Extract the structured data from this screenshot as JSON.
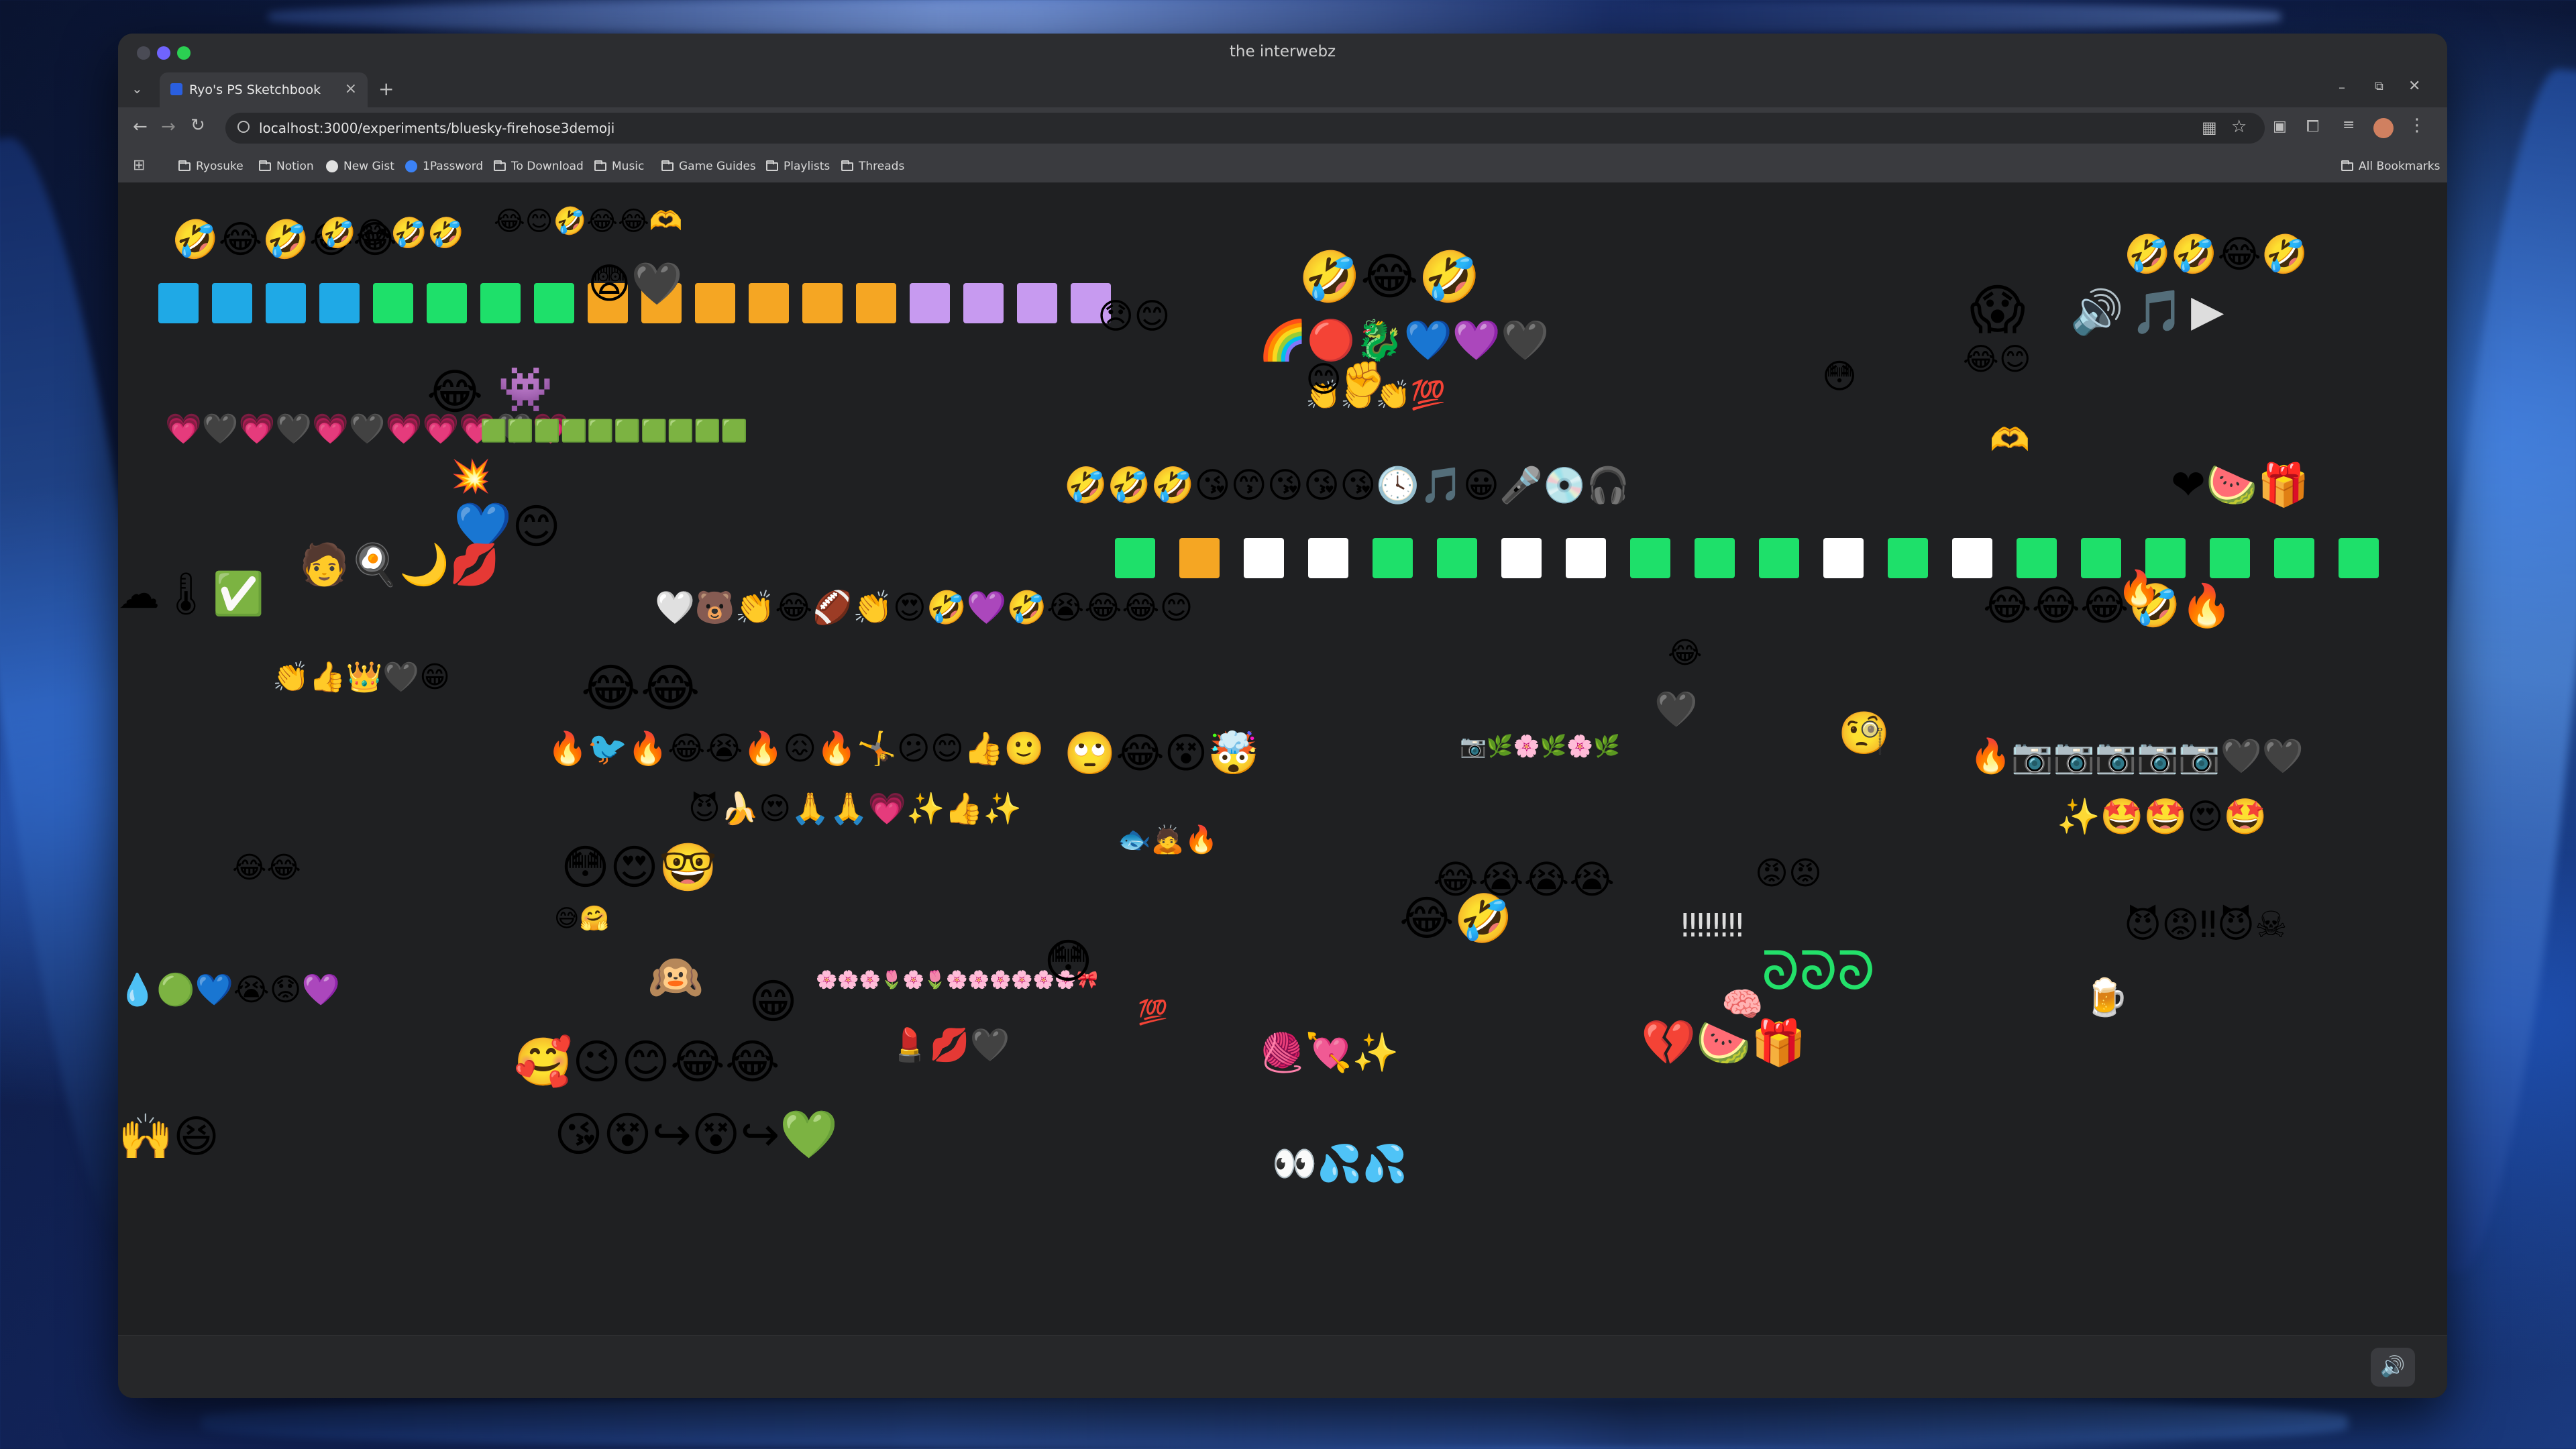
{
  "window": {
    "title": "the interwebz"
  },
  "tab": {
    "title": "Ryo's PS Sketchbook",
    "close": "×",
    "new_tab": "+"
  },
  "toolbar": {
    "url": "localhost:3000/experiments/bluesky-firehose3demoji",
    "back": "←",
    "forward": "→",
    "reload": "↻"
  },
  "bookmarks": {
    "items": [
      "Ryosuke",
      "Notion",
      "New Gist",
      "1Password",
      "To Download",
      "Music",
      "Game Guides",
      "Playlists",
      "Threads"
    ],
    "all": "All Bookmarks"
  },
  "footer": {
    "sound_icon": "speaker-icon"
  },
  "colors": {
    "window_bg": "#1f2022",
    "green": "#1ee06a",
    "orange": "#f5a623",
    "purple": "#c79af0",
    "blue": "#1fa9e6",
    "white": "#ffffff"
  },
  "emoji_rows": {
    "row1_squares": [
      "blue",
      "blue",
      "blue",
      "blue",
      "green",
      "green",
      "green",
      "green",
      "orange",
      "orange",
      "orange",
      "orange",
      "orange",
      "orange",
      "purple",
      "purple",
      "purple",
      "purple"
    ],
    "row2_squares": [
      "green",
      "orange",
      "white",
      "white",
      "green",
      "green",
      "white",
      "white",
      "green",
      "green",
      "green",
      "white",
      "green",
      "white",
      "green",
      "green",
      "green",
      "green",
      "green",
      "green"
    ],
    "hearts_row": "💗🖤💗🖤💗🖤💗💗💗🖤💗",
    "green_dots": "🟩🟩🟩🟩🟩🟩🟩🟩🟩🟩"
  }
}
